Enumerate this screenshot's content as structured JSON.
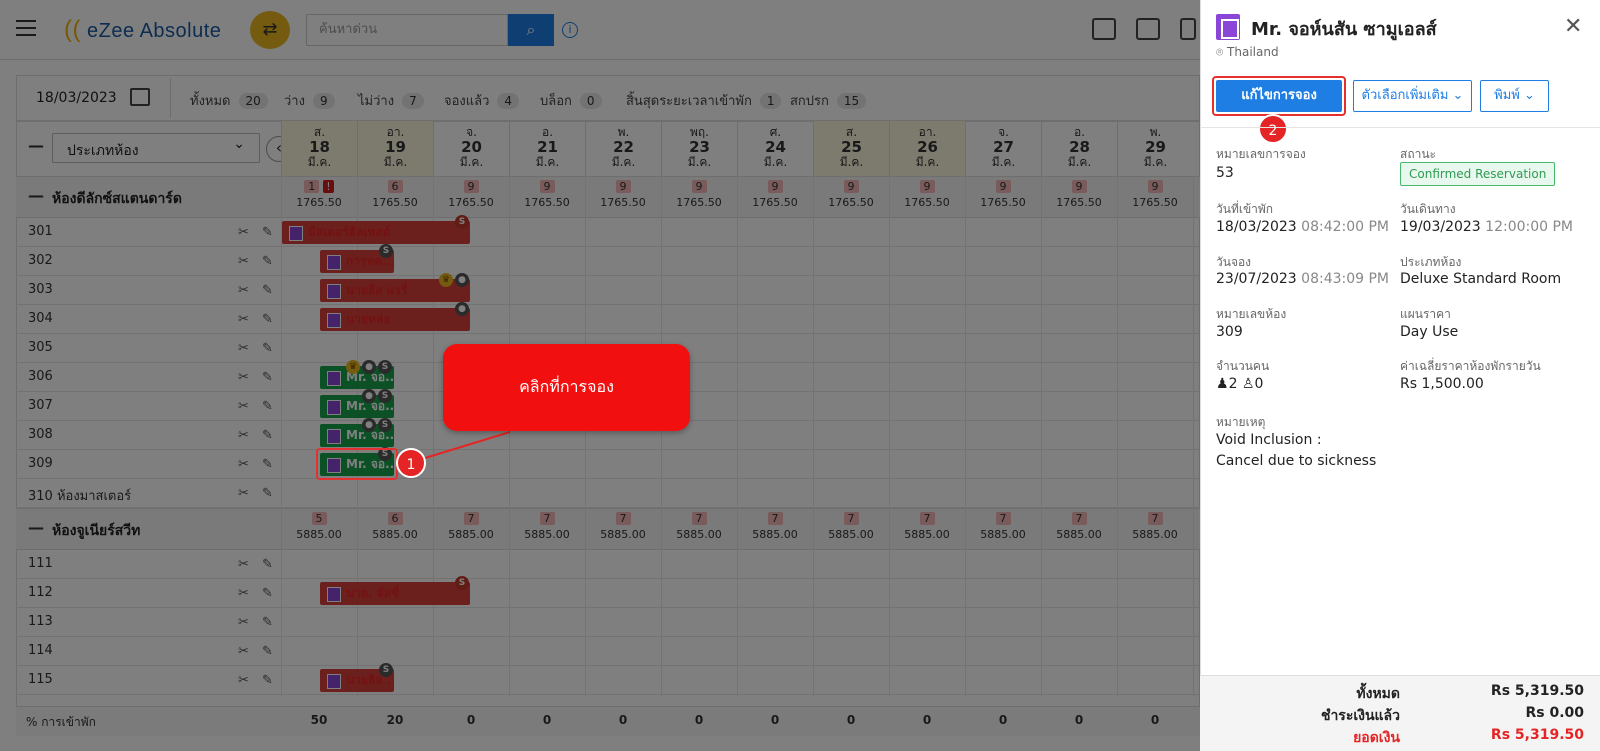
{
  "header": {
    "logo_text": "eZee Absolute",
    "search_placeholder": "ค้นหาด่วน"
  },
  "toolbar": {
    "date": "18/03/2023",
    "counts": [
      {
        "label": "ทั้งหมด",
        "value": "20"
      },
      {
        "label": "ว่าง",
        "value": "9"
      },
      {
        "label": "ไม่ว่าง",
        "value": "7"
      },
      {
        "label": "จองแล้ว",
        "value": "4"
      },
      {
        "label": "บล็อก",
        "value": "0"
      },
      {
        "label": "สิ้นสุดระยะเวลาเข้าพัก",
        "value": "1"
      },
      {
        "label": "สกปรก",
        "value": "15"
      }
    ]
  },
  "grid": {
    "room_type_select": "ประเภทห้อง",
    "days": [
      {
        "dow": "ส.",
        "day": "18",
        "month": "มี.ค."
      },
      {
        "dow": "อา.",
        "day": "19",
        "month": "มี.ค."
      },
      {
        "dow": "จ.",
        "day": "20",
        "month": "มี.ค."
      },
      {
        "dow": "อ.",
        "day": "21",
        "month": "มี.ค."
      },
      {
        "dow": "พ.",
        "day": "22",
        "month": "มี.ค."
      },
      {
        "dow": "พฤ.",
        "day": "23",
        "month": "มี.ค."
      },
      {
        "dow": "ศ.",
        "day": "24",
        "month": "มี.ค."
      },
      {
        "dow": "ส.",
        "day": "25",
        "month": "มี.ค."
      },
      {
        "dow": "อา.",
        "day": "26",
        "month": "มี.ค."
      },
      {
        "dow": "จ.",
        "day": "27",
        "month": "มี.ค."
      },
      {
        "dow": "อ.",
        "day": "28",
        "month": "มี.ค."
      },
      {
        "dow": "พ.",
        "day": "29",
        "month": "มี.ค."
      }
    ],
    "cat1": {
      "name": "ห้องดีลักซ์สแตนดาร์ด",
      "avail": [
        "1",
        "6",
        "9",
        "9",
        "9",
        "9",
        "9",
        "9",
        "9",
        "9",
        "9",
        "9"
      ],
      "price": "1765.50",
      "rooms": [
        "301",
        "302",
        "303",
        "304",
        "305",
        "306",
        "307",
        "308",
        "309",
        "310 ห้องมาสเตอร์"
      ]
    },
    "cat2": {
      "name": "ห้องจูเนียร์สวีท",
      "avail": [
        "5",
        "6",
        "7",
        "7",
        "7",
        "7",
        "7",
        "7",
        "7",
        "7",
        "7",
        "7"
      ],
      "price": "5885.00",
      "rooms": [
        "111",
        "112",
        "113",
        "114",
        "115"
      ]
    },
    "bookings": {
      "b301": "มิสเตอร์ฮิลเทสต์",
      "b302": "การทด...",
      "b303": "นายฮิล แรรี่",
      "b304": "นายหล่อ",
      "b306": "Mr. จอ...",
      "b307": "Mr. จอ...",
      "b308": "Mr. จอ...",
      "b309": "Mr. จอ...",
      "b112": "นาย. จัสซี่",
      "b115": "นายฮิล ..."
    },
    "footer_label": "% การเข้าพัก",
    "occupancy": [
      "50",
      "20",
      "0",
      "0",
      "0",
      "0",
      "0",
      "0",
      "0",
      "0",
      "0",
      "0"
    ]
  },
  "annotations": {
    "callout": "คลิกที่การจอง",
    "step1": "1",
    "step2": "2"
  },
  "panel": {
    "guest_name": "Mr. จอห์นสัน ซามูเอลส์",
    "location": "Thailand",
    "edit_button": "แก้ไขการจอง",
    "more_button": "ตัวเลือกเพิ่มเติม",
    "print_button": "พิมพ์",
    "res_no_label": "หมายเลขการจอง",
    "res_no": "53",
    "status_label": "สถานะ",
    "status": "Confirmed Reservation",
    "checkin_label": "วันที่เข้าพัก",
    "checkin_date": "18/03/2023",
    "checkin_time": "08:42:00 PM",
    "checkout_label": "วันเดินทาง",
    "checkout_date": "19/03/2023",
    "checkout_time": "12:00:00 PM",
    "booking_label": "วันจอง",
    "booking_date": "23/07/2023",
    "booking_time": "08:43:09 PM",
    "roomtype_label": "ประเภทห้อง",
    "roomtype": "Deluxe Standard Room",
    "roomno_label": "หมายเลขห้อง",
    "roomno": "309",
    "rateplan_label": "แผนราคา",
    "rateplan": "Day Use",
    "pax_label": "จำนวนคน",
    "adults": "2",
    "children": "0",
    "avgrate_label": "ค่าเฉลี่ยราคาห้องพักรายวัน",
    "avgrate": "Rs 1,500.00",
    "note_label": "หมายเหตุ",
    "note1": "Void Inclusion :",
    "note2": "Cancel due to sickness",
    "total_label": "ทั้งหมด",
    "total": "Rs 5,319.50",
    "paid_label": "ชำระเงินแล้ว",
    "paid": "Rs 0.00",
    "balance_label": "ยอดเงิน",
    "balance": "Rs 5,319.50"
  }
}
